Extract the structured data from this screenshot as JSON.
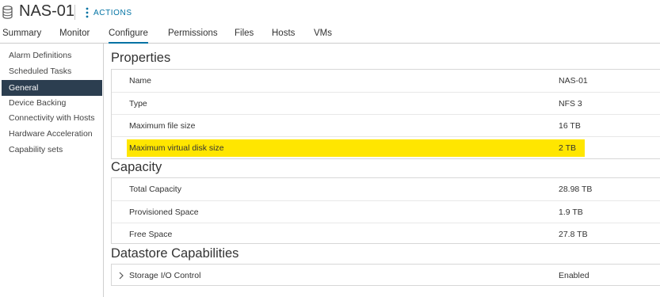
{
  "header": {
    "title": "NAS-01",
    "actions_label": "ACTIONS"
  },
  "tabs": [
    {
      "label": "Summary"
    },
    {
      "label": "Monitor"
    },
    {
      "label": "Configure",
      "active": true
    },
    {
      "label": "Permissions"
    },
    {
      "label": "Files"
    },
    {
      "label": "Hosts"
    },
    {
      "label": "VMs"
    }
  ],
  "sidebar": {
    "items": [
      {
        "label": "Alarm Definitions"
      },
      {
        "label": "Scheduled Tasks"
      },
      {
        "label": "General",
        "active": true
      },
      {
        "label": "Device Backing"
      },
      {
        "label": "Connectivity with Hosts"
      },
      {
        "label": "Hardware Acceleration"
      },
      {
        "label": "Capability sets"
      }
    ]
  },
  "properties": {
    "title": "Properties",
    "rows": [
      {
        "key": "Name",
        "value": "NAS-01"
      },
      {
        "key": "Type",
        "value": "NFS 3"
      },
      {
        "key": "Maximum file size",
        "value": "16 TB"
      },
      {
        "key": "Maximum virtual disk size",
        "value": "2 TB",
        "highlighted": true
      }
    ]
  },
  "capacity": {
    "title": "Capacity",
    "rows": [
      {
        "key": "Total Capacity",
        "value": "28.98 TB"
      },
      {
        "key": "Provisioned Space",
        "value": "1.9 TB"
      },
      {
        "key": "Free Space",
        "value": "27.8 TB"
      }
    ]
  },
  "datastore_capabilities": {
    "title": "Datastore Capabilities",
    "rows": [
      {
        "key": "Storage I/O Control",
        "value": "Enabled"
      }
    ]
  },
  "colors": {
    "accent": "#0072a3",
    "sidebar_active_bg": "#2c3e50",
    "highlight": "#ffe600"
  }
}
